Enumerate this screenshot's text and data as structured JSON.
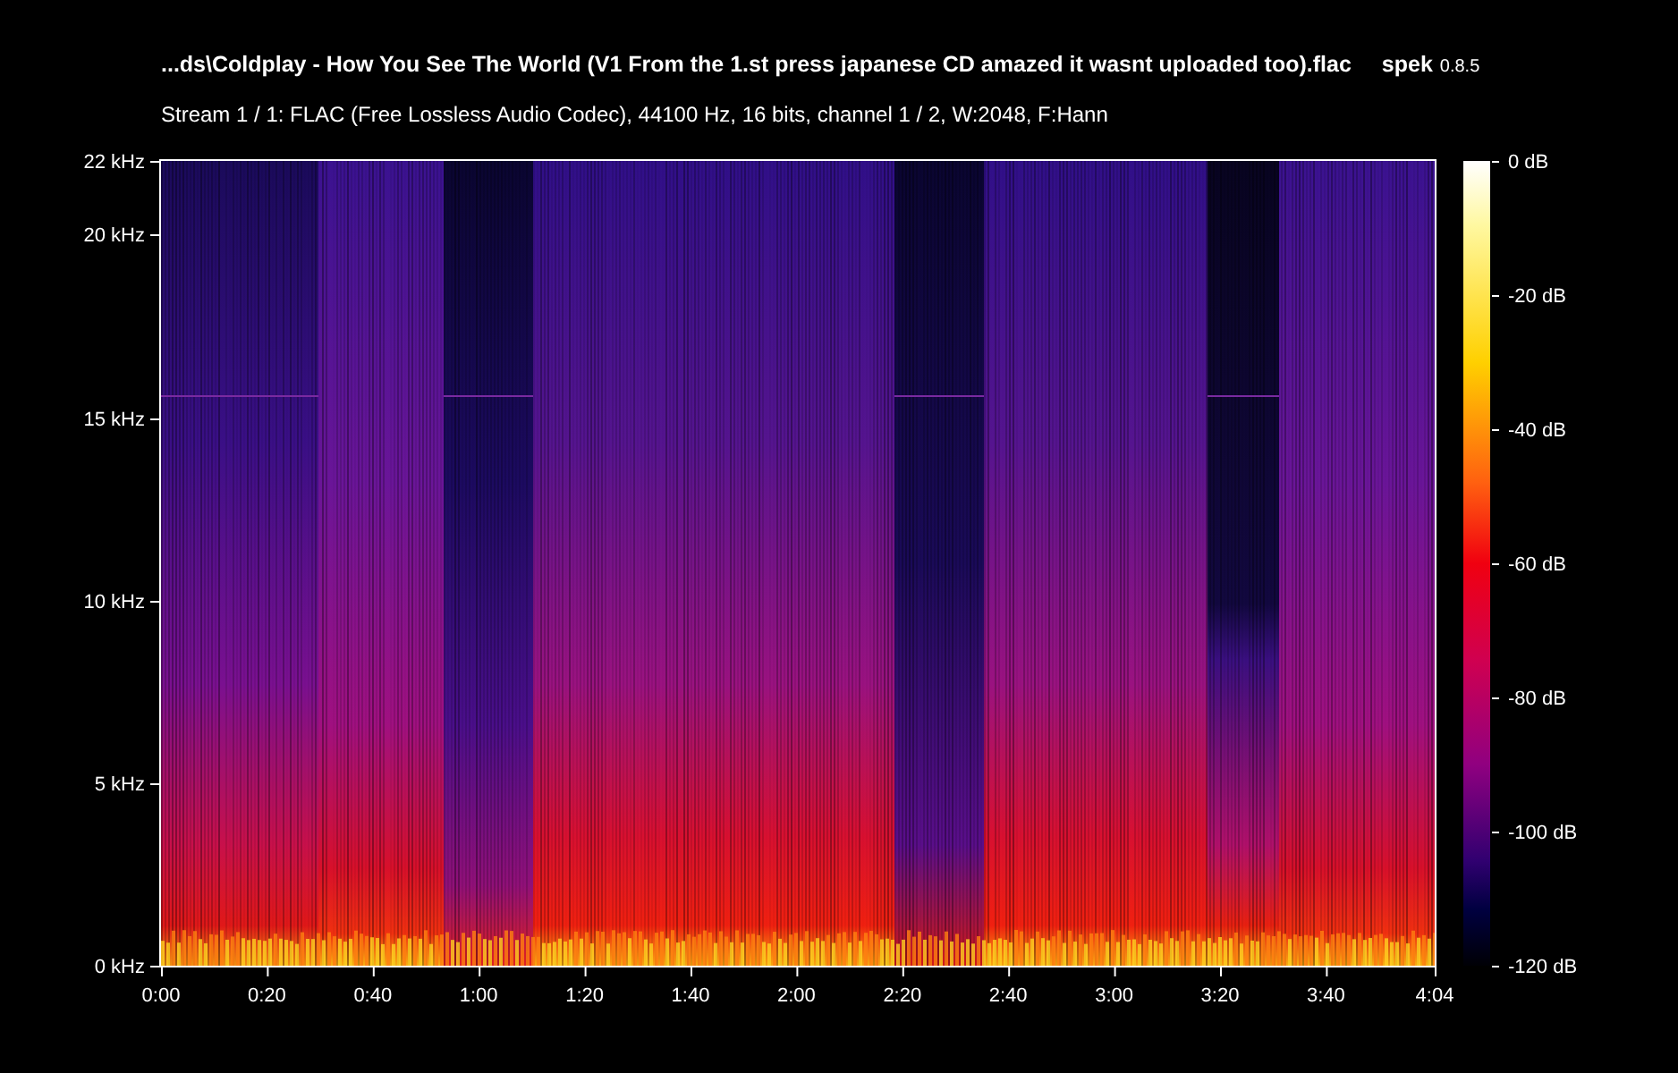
{
  "title": {
    "file": "...ds\\Coldplay - How You See The World (V1 From the 1.st press japanese CD amazed it wasnt uploaded too).flac",
    "app": "spek",
    "version": "0.8.5"
  },
  "stream_info": "Stream 1 / 1: FLAC (Free Lossless Audio Codec), 44100 Hz, 16 bits, channel 1 / 2, W:2048, F:Hann",
  "frequency_axis": {
    "ticks": [
      "22 kHz",
      "20 kHz",
      "15 kHz",
      "10 kHz",
      "5 kHz",
      "0 kHz"
    ]
  },
  "time_axis": {
    "ticks": [
      "0:00",
      "0:20",
      "0:40",
      "1:00",
      "1:20",
      "1:40",
      "2:00",
      "2:20",
      "2:40",
      "3:00",
      "3:20",
      "3:40",
      "4:04"
    ]
  },
  "color_scale": {
    "ticks": [
      "0 dB",
      "-20 dB",
      "-40 dB",
      "-60 dB",
      "-80 dB",
      "-100 dB",
      "-120 dB"
    ]
  }
}
